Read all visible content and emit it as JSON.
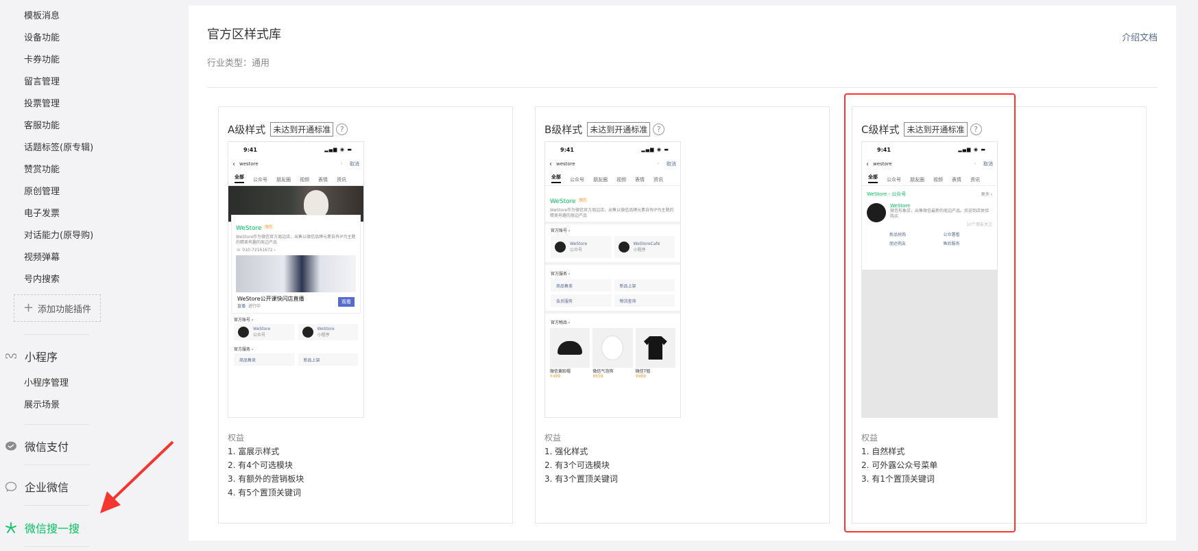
{
  "sidebar": {
    "items_top": [
      "模板消息",
      "设备功能",
      "卡券功能",
      "留言管理",
      "投票管理",
      "客服功能",
      "话题标签(原专辑)",
      "赞赏功能",
      "原创管理",
      "电子发票",
      "对话能力(原导购)",
      "视频弹幕",
      "号内搜索"
    ],
    "add_plugin": "添加功能插件",
    "miniprogram": {
      "label": "小程序",
      "items": [
        "小程序管理",
        "展示场景"
      ]
    },
    "pay": "微信支付",
    "work": "企业微信",
    "search": "微信搜一搜"
  },
  "main": {
    "title": "官方区样式库",
    "industry": "行业类型：通用",
    "doc_link": "介绍文档",
    "columns": [
      {
        "name": "A级样式",
        "tag": "未达到开通标准",
        "benefits_title": "权益",
        "benefits": [
          "1. 富展示样式",
          "2. 有4个可选模块",
          "3. 有额外的营销板块",
          "4. 有5个置顶关键词"
        ]
      },
      {
        "name": "B级样式",
        "tag": "未达到开通标准",
        "benefits_title": "权益",
        "benefits": [
          "1. 强化样式",
          "2. 有3个可选模块",
          "3. 有3个置顶关键词"
        ]
      },
      {
        "name": "C级样式",
        "tag": "未达到开通标准",
        "benefits_title": "权益",
        "benefits": [
          "1. 自然样式",
          "2. 可外露公众号菜单",
          "3. 有1个置顶关键词"
        ]
      }
    ]
  },
  "phone": {
    "time": "9:41",
    "query": "westore",
    "cancel": "取消",
    "tabs": [
      "全部",
      "公众号",
      "朋友圈",
      "视频",
      "表情",
      "资讯"
    ],
    "brand": "WeStore",
    "brand_badge": "官方",
    "desc": "WeStore作为微信官方周边店，出售以微信品牌元素自有IP为主题的精美有趣的周边产品",
    "phone_num": "010-72161672",
    "live_title": "WeStore公开课快闪店直播",
    "live_tag": "直播",
    "live_status": "进行中",
    "live_btn": "观看",
    "sec_accounts": "官方账号",
    "sec_services": "官方服务",
    "sec_goods": "官方物品",
    "acc1": "WeStore",
    "acc1_type": "公众号",
    "acc2": "WeStore",
    "acc2_type": "小程序",
    "acc2b": "WeStoreCafe",
    "svc": [
      "商品售卖",
      "新品上架",
      "会员服务",
      "物流查询"
    ],
    "goods": [
      {
        "name": "微信黄脸帽",
        "price": "¥499"
      },
      {
        "name": "微信气泡狗",
        "price": "¥659"
      },
      {
        "name": "微信T恤",
        "price": "¥989"
      }
    ],
    "c_brand_line": "WeStore - 公众号",
    "c_more": "更多",
    "c_desc": "微信形象店，出售微信最新的周边产品。欢迎到店体验购买",
    "c_followers": "10个朋友关注",
    "c_menu": [
      "新品抢购",
      "公众署看",
      "朋达购友",
      "售后服务"
    ]
  }
}
